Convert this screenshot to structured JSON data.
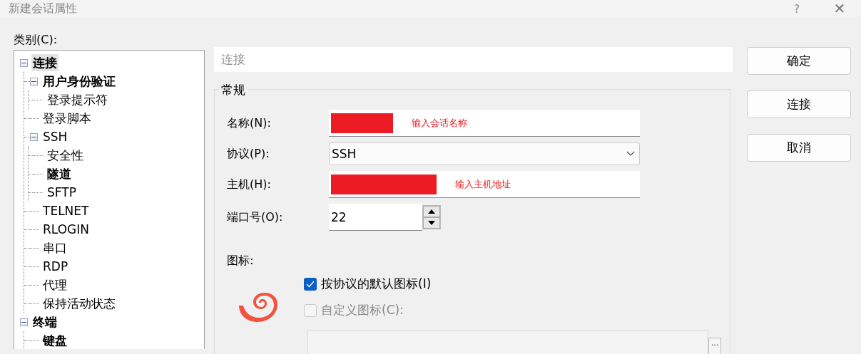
{
  "window": {
    "title": "新建会话属性",
    "help": "?",
    "close": "✕"
  },
  "category_label": "类别(C):",
  "tree": [
    {
      "label": "连接",
      "bold": true,
      "selected": true,
      "expanded": true,
      "children": [
        {
          "label": "用户身份验证",
          "bold": true,
          "selected": false,
          "expanded": true,
          "children": [
            {
              "label": "登录提示符",
              "bold": false,
              "selected": false
            }
          ]
        },
        {
          "label": "登录脚本",
          "bold": false,
          "selected": false
        },
        {
          "label": "SSH",
          "bold": false,
          "selected": false,
          "expanded": true,
          "children": [
            {
              "label": "安全性",
              "bold": false,
              "selected": false
            },
            {
              "label": "隧道",
              "bold": true,
              "selected": false
            },
            {
              "label": "SFTP",
              "bold": false,
              "selected": false
            }
          ]
        },
        {
          "label": "TELNET",
          "bold": false,
          "selected": false
        },
        {
          "label": "RLOGIN",
          "bold": false,
          "selected": false
        },
        {
          "label": "串口",
          "bold": false,
          "selected": false
        },
        {
          "label": "RDP",
          "bold": false,
          "selected": false
        },
        {
          "label": "代理",
          "bold": false,
          "selected": false
        },
        {
          "label": "保持活动状态",
          "bold": false,
          "selected": false
        }
      ]
    },
    {
      "label": "终端",
      "bold": true,
      "selected": false,
      "expanded": true,
      "children": [
        {
          "label": "键盘",
          "bold": true,
          "selected": false
        }
      ]
    }
  ],
  "panel_header": "连接",
  "group": {
    "title": "常规",
    "fields": [
      {
        "kind": "text",
        "label": "名称(N):",
        "redacted": true,
        "annotation": "输入会话名称"
      },
      {
        "kind": "dropdown",
        "label": "协议(P):",
        "value": "SSH"
      },
      {
        "kind": "text",
        "label": "主机(H):",
        "redacted": true,
        "annotation": "输入主机地址"
      },
      {
        "kind": "spinner",
        "label": "端口号(O):",
        "value": "22"
      }
    ],
    "icon_label": "图标:",
    "checkboxes": [
      {
        "label": "按协议的默认图标(I)",
        "checked": true,
        "disabled": false
      },
      {
        "label": "自定义图标(C):",
        "checked": false,
        "disabled": true
      }
    ],
    "browse_button": "..."
  },
  "buttons": [
    "确定",
    "连接",
    "取消"
  ]
}
